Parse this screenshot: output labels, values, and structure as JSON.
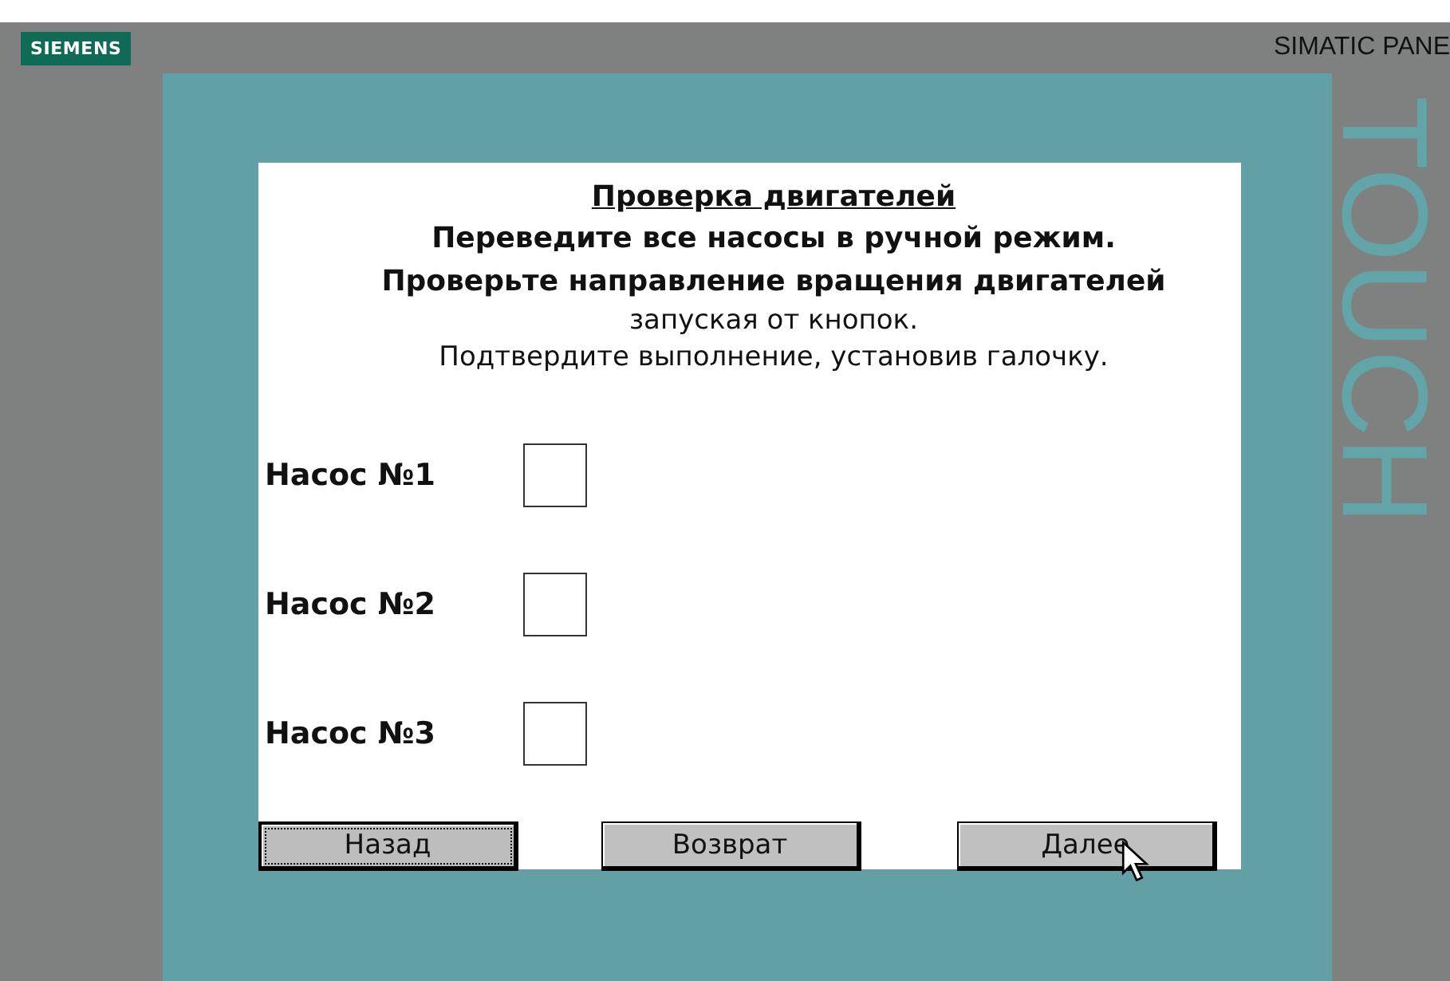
{
  "device": {
    "brand": "SIEMENS",
    "model": "SIMATIC PANE",
    "side_label": "TOUCH"
  },
  "screen": {
    "title": "Проверка двигателей",
    "instructions": [
      {
        "text": "Переведите все насосы в ручной режим.",
        "bold": true
      },
      {
        "text": "Проверьте направление вращения двигателей",
        "bold": true
      },
      {
        "text": "запуская от кнопок.",
        "bold": false
      },
      {
        "text": "Подтвердите выполнение, установив галочку.",
        "bold": false
      }
    ],
    "pumps": [
      {
        "label": "Насос №1",
        "checked": false
      },
      {
        "label": "Насос №2",
        "checked": false
      },
      {
        "label": "Насос №3",
        "checked": false
      }
    ],
    "buttons": [
      {
        "label": "Назад",
        "focused": true
      },
      {
        "label": "Возврат",
        "focused": false
      },
      {
        "label": "Далее",
        "focused": false
      }
    ]
  }
}
